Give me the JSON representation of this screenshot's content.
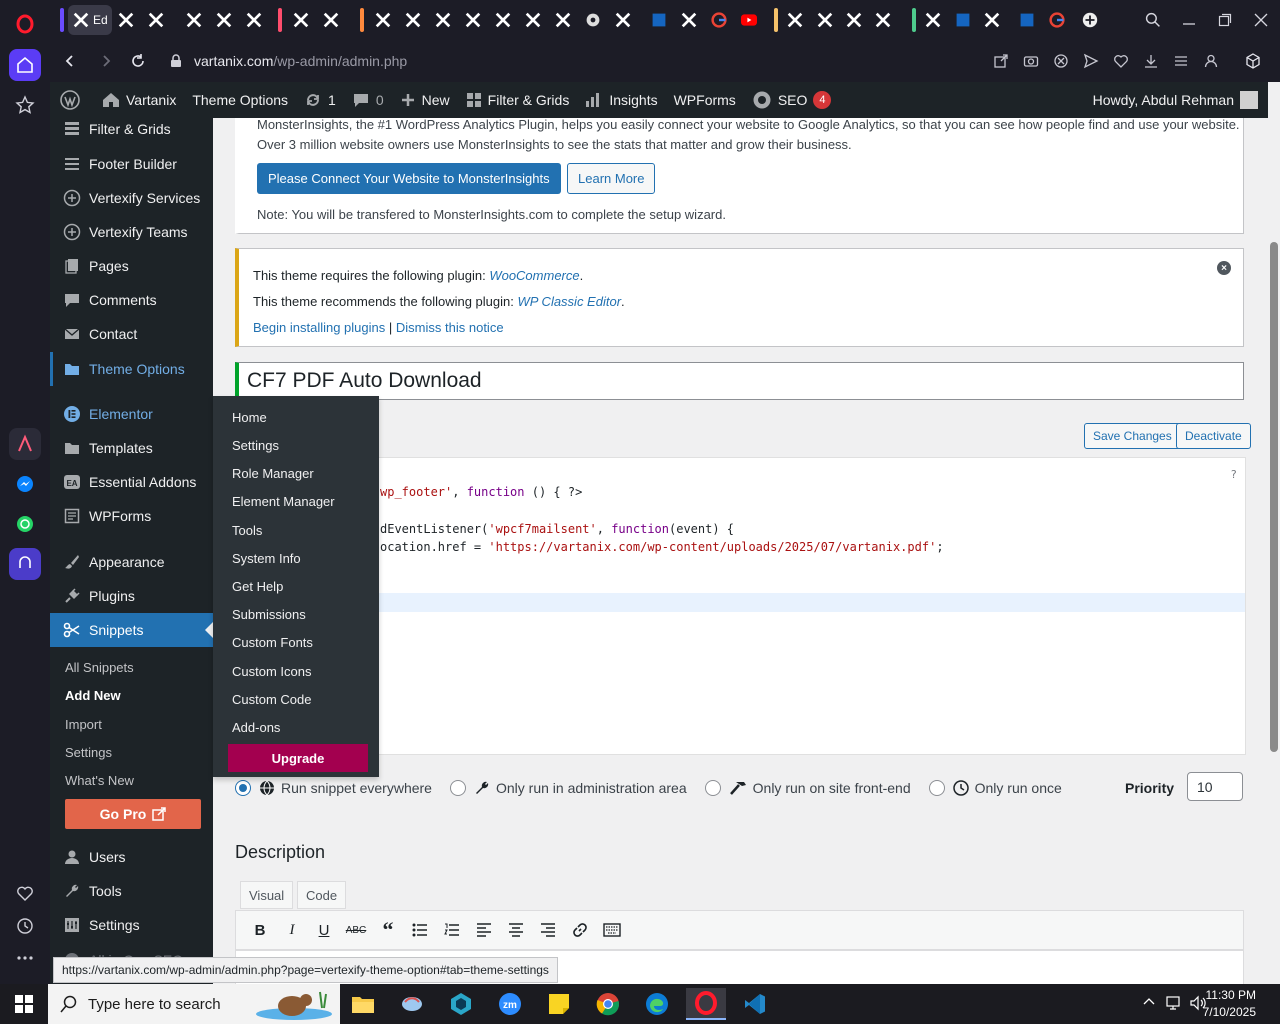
{
  "browser": {
    "url_domain": "vartanix.com",
    "url_path": "/wp-admin/admin.php",
    "first_tab_label": "Ed"
  },
  "adminbar": {
    "site_name": "Vartanix",
    "theme_options": "Theme Options",
    "updates_count": "1",
    "comments_count": "0",
    "new_label": "New",
    "filter_grids": "Filter & Grids",
    "insights": "Insights",
    "wpforms": "WPForms",
    "seo": "SEO",
    "seo_badge": "4",
    "howdy": "Howdy, Abdul Rehman"
  },
  "menu": {
    "items": [
      {
        "label": "Filter & Grids",
        "icon": "grid-icon"
      },
      {
        "label": "Footer Builder",
        "icon": "footer-icon"
      },
      {
        "label": "Vertexify Services",
        "icon": "plus-circle-icon"
      },
      {
        "label": "Vertexify Teams",
        "icon": "plus-circle-icon"
      },
      {
        "label": "Pages",
        "icon": "pages-icon"
      },
      {
        "label": "Comments",
        "icon": "comment-icon"
      },
      {
        "label": "Contact",
        "icon": "mail-icon"
      },
      {
        "label": "Theme Options",
        "icon": "folder-icon"
      },
      {
        "label": "Elementor",
        "icon": "elementor-icon"
      },
      {
        "label": "Templates",
        "icon": "folder-icon"
      },
      {
        "label": "Essential Addons",
        "icon": "ea-icon"
      },
      {
        "label": "WPForms",
        "icon": "form-icon"
      },
      {
        "label": "Appearance",
        "icon": "brush-icon"
      },
      {
        "label": "Plugins",
        "icon": "plug-icon"
      },
      {
        "label": "Snippets",
        "icon": "scissors-icon"
      },
      {
        "label": "Users",
        "icon": "user-icon"
      },
      {
        "label": "Tools",
        "icon": "wrench-icon"
      },
      {
        "label": "Settings",
        "icon": "settings-icon"
      },
      {
        "label": "All in One SEO",
        "icon": "seo-icon"
      }
    ],
    "submenu": [
      "All Snippets",
      "Add New",
      "Import",
      "Settings",
      "What's New"
    ],
    "go_pro": "Go Pro"
  },
  "flyout": {
    "items": [
      "Home",
      "Settings",
      "Role Manager",
      "Element Manager",
      "Tools",
      "System Info",
      "Get Help",
      "Submissions",
      "Custom Fonts",
      "Custom Icons",
      "Custom Code",
      "Add-ons"
    ],
    "upgrade": "Upgrade"
  },
  "notices": {
    "mi_line1": "MonsterInsights, the #1 WordPress Analytics Plugin, helps you easily connect your website to Google Analytics, so that you can see how people find and use your website.",
    "mi_line2": "Over 3 million website owners use MonsterInsights to see the stats that matter and grow their business.",
    "mi_connect": "Please Connect Your Website to MonsterInsights",
    "mi_learn": "Learn More",
    "mi_note": "Note: You will be transfered to MonsterInsights.com to complete the setup wizard.",
    "tgm_req_text": "This theme requires the following plugin:",
    "tgm_req_plugin": "WooCommerce",
    "tgm_rec_text": "This theme recommends the following plugin:",
    "tgm_rec_plugin": "WP Classic Editor",
    "tgm_begin": "Begin installing plugins",
    "tgm_sep": "|",
    "tgm_dismiss": "Dismiss this notice"
  },
  "snippet": {
    "title": "CF7 PDF Auto Download",
    "save": "Save Changes",
    "deactivate": "Deactivate",
    "help": "?",
    "code": {
      "l1_a": "wp_footer'",
      "l1_b": ", ",
      "l1_c": "function",
      "l1_d": " () { ?>",
      "l2_a": "dEventListener(",
      "l2_b": "'wpcf7mailsent'",
      "l2_c": ", ",
      "l2_d": "function",
      "l2_e": "(event) {",
      "l3_a": "ocation.href = ",
      "l3_b": "'https://vartanix.com/wp-content/uploads/2025/07/vartanix.pdf'",
      "l3_c": ";"
    },
    "scope": {
      "everywhere": "Run snippet everywhere",
      "admin": "Only run in administration area",
      "front": "Only run on site front-end",
      "once": "Only run once"
    },
    "priority_label": "Priority",
    "priority_value": "10",
    "description": "Description",
    "tab_visual": "Visual",
    "tab_code": "Code"
  },
  "status_url": "https://vartanix.com/wp-admin/admin.php?page=vertexify-theme-option#tab=theme-settings",
  "taskbar": {
    "search_placeholder": "Type here to search",
    "time": "11:30 PM",
    "date": "7/10/2025"
  },
  "colors": {
    "wp_blue": "#2271b1",
    "admin_dark": "#1d2327",
    "upgrade": "#a3004f",
    "go_pro": "#e2654a"
  }
}
